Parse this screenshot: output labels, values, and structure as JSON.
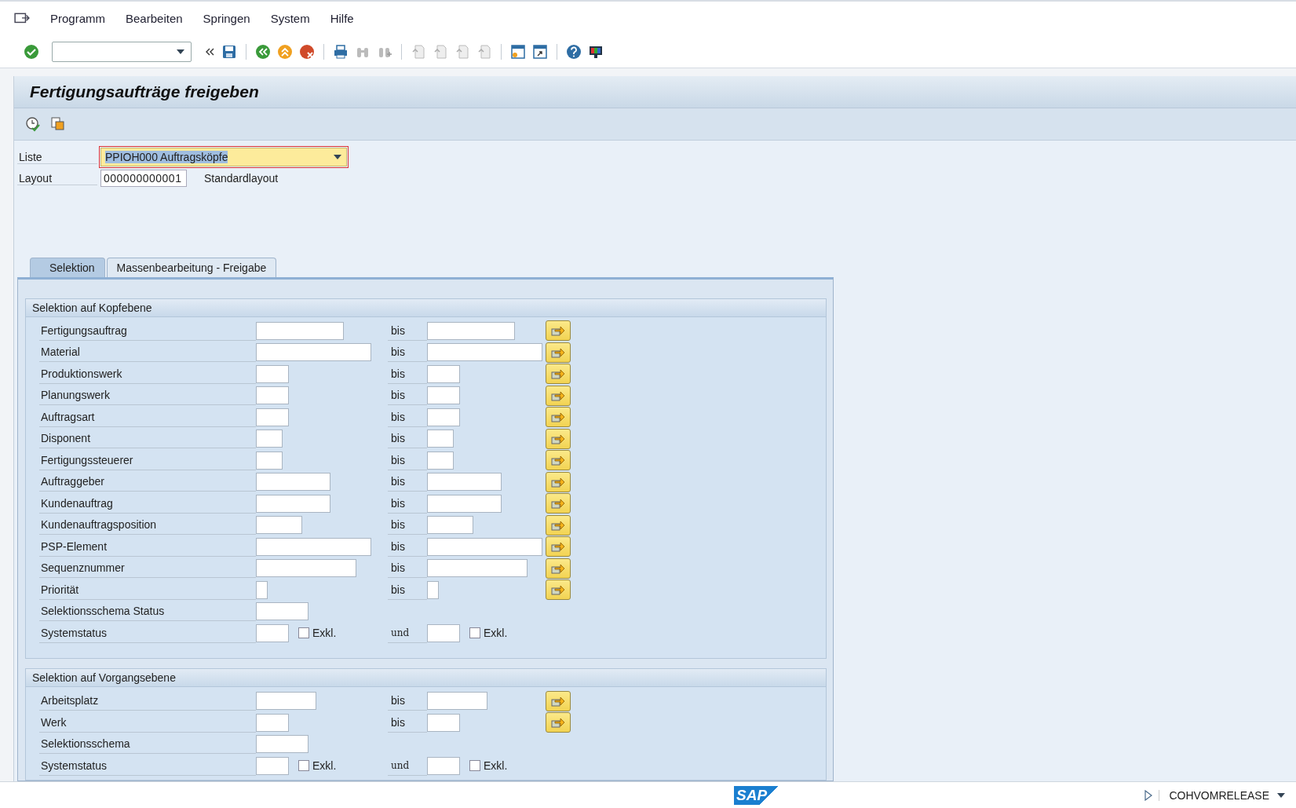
{
  "menu": [
    {
      "label": "Programm"
    },
    {
      "label": "Bearbeiten"
    },
    {
      "label": "Springen"
    },
    {
      "label": "System"
    },
    {
      "label": "Hilfe"
    }
  ],
  "title": "Fertigungsaufträge freigeben",
  "header_fields": [
    {
      "label": "Liste",
      "value": "PPIOH000 Auftragsköpfe",
      "kind": "dropdown"
    },
    {
      "label": "Layout",
      "value": "000000000001",
      "kind": "text",
      "description": "Standardlayout"
    }
  ],
  "tabs": [
    {
      "label": "Selektion",
      "selected": true
    },
    {
      "label": "Massenbearbeitung - Freigabe",
      "selected": false
    }
  ],
  "groups": [
    {
      "title": "Selektion auf Kopfebene",
      "rows": [
        {
          "label": "Fertigungsauftrag",
          "kind": "range",
          "to": "bis"
        },
        {
          "label": "Material",
          "kind": "range",
          "to": "bis"
        },
        {
          "label": "Produktionswerk",
          "kind": "range",
          "to": "bis"
        },
        {
          "label": "Planungswerk",
          "kind": "range",
          "to": "bis"
        },
        {
          "label": "Auftragsart",
          "kind": "range",
          "to": "bis"
        },
        {
          "label": "Disponent",
          "kind": "range",
          "to": "bis"
        },
        {
          "label": "Fertigungssteuerer",
          "kind": "range",
          "to": "bis"
        },
        {
          "label": "Auftraggeber",
          "kind": "range",
          "to": "bis"
        },
        {
          "label": "Kundenauftrag",
          "kind": "range",
          "to": "bis"
        },
        {
          "label": "Kundenauftragsposition",
          "kind": "range",
          "to": "bis"
        },
        {
          "label": "PSP-Element",
          "kind": "range",
          "to": "bis"
        },
        {
          "label": "Sequenznummer",
          "kind": "range",
          "to": "bis"
        },
        {
          "label": "Priorität",
          "kind": "range",
          "to": "bis"
        },
        {
          "label": "Selektionsschema Status",
          "kind": "single"
        },
        {
          "label": "Systemstatus",
          "kind": "status",
          "exclude_label": "Exkl.",
          "exclude_checked": false,
          "and": "und",
          "exclude2_label": "Exkl.",
          "exclude2_checked": false
        }
      ]
    },
    {
      "title": "Selektion auf Vorgangsebene",
      "rows": [
        {
          "label": "Arbeitsplatz",
          "kind": "range",
          "to": "bis"
        },
        {
          "label": "Werk",
          "kind": "range",
          "to": "bis"
        },
        {
          "label": "Selektionsschema",
          "kind": "single"
        },
        {
          "label": "Systemstatus",
          "kind": "status",
          "exclude_label": "Exkl.",
          "exclude_checked": false,
          "and": "und",
          "exclude2_label": "Exkl.",
          "exclude2_checked": false
        }
      ]
    }
  ],
  "status_bar": {
    "logo": "SAP",
    "transaction": "COHVOMRELEASE"
  }
}
